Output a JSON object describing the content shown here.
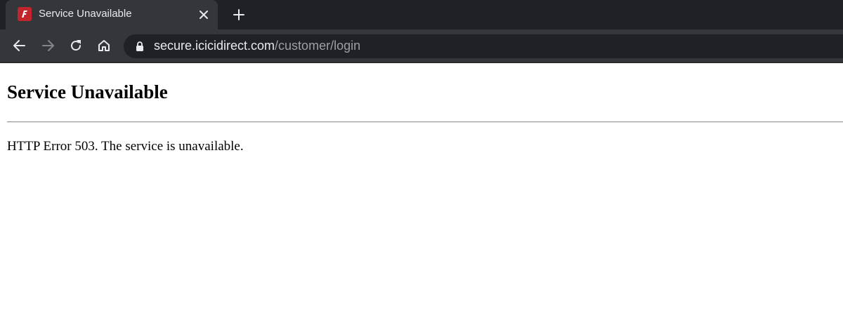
{
  "browser": {
    "tab": {
      "title": "Service Unavailable",
      "favicon": "icicidirect-logo-icon"
    },
    "address_bar": {
      "host": "secure.icicidirect.com",
      "path": "/customer/login"
    }
  },
  "page": {
    "heading": "Service Unavailable",
    "message": "HTTP Error 503. The service is unavailable."
  },
  "colors": {
    "browser_dark": "#202124",
    "toolbar": "#35363a",
    "favicon_red": "#c0262c"
  }
}
